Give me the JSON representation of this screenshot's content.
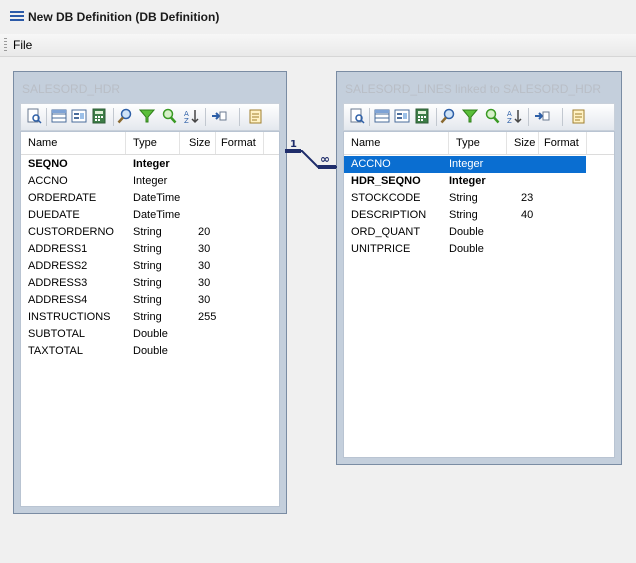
{
  "window": {
    "title": "New DB Definition (DB Definition)"
  },
  "menu": {
    "items": [
      "File"
    ]
  },
  "columns": {
    "name": "Name",
    "type": "Type",
    "size": "Size",
    "format": "Format"
  },
  "left_table": {
    "title": "SALESORD_HDR",
    "rows": [
      {
        "name": "SEQNO",
        "type": "Integer",
        "size": "",
        "bold": true
      },
      {
        "name": "ACCNO",
        "type": "Integer",
        "size": ""
      },
      {
        "name": "ORDERDATE",
        "type": "DateTime",
        "size": ""
      },
      {
        "name": "DUEDATE",
        "type": "DateTime",
        "size": ""
      },
      {
        "name": "CUSTORDERNO",
        "type": "String",
        "size": "20"
      },
      {
        "name": "ADDRESS1",
        "type": "String",
        "size": "30"
      },
      {
        "name": "ADDRESS2",
        "type": "String",
        "size": "30"
      },
      {
        "name": "ADDRESS3",
        "type": "String",
        "size": "30"
      },
      {
        "name": "ADDRESS4",
        "type": "String",
        "size": "30"
      },
      {
        "name": "INSTRUCTIONS",
        "type": "String",
        "size": "255"
      },
      {
        "name": "SUBTOTAL",
        "type": "Double",
        "size": ""
      },
      {
        "name": "TAXTOTAL",
        "type": "Double",
        "size": ""
      }
    ]
  },
  "right_table": {
    "title": "SALESORD_LINES linked to SALESORD_HDR",
    "rows": [
      {
        "name": "ACCNO",
        "type": "Integer",
        "size": "",
        "selected": true
      },
      {
        "name": "HDR_SEQNO",
        "type": "Integer",
        "size": "",
        "bold": true
      },
      {
        "name": "STOCKCODE",
        "type": "String",
        "size": "23"
      },
      {
        "name": "DESCRIPTION",
        "type": "String",
        "size": "40"
      },
      {
        "name": "ORD_QUANT",
        "type": "Double",
        "size": ""
      },
      {
        "name": "UNITPRICE",
        "type": "Double",
        "size": ""
      }
    ]
  },
  "relation": {
    "one_label": "1",
    "many_label": "∞"
  },
  "toolbar_icons": [
    "preview-icon",
    "grid-icon",
    "form-icon",
    "calc-icon",
    "search-icon",
    "filter-icon",
    "filter-search-icon",
    "sort-az-icon",
    "insert-icon",
    "notes-icon"
  ],
  "colors": {
    "selection": "#0a6ed1",
    "panel": "#c4cfdc",
    "relation_line": "#1f2d6b"
  }
}
